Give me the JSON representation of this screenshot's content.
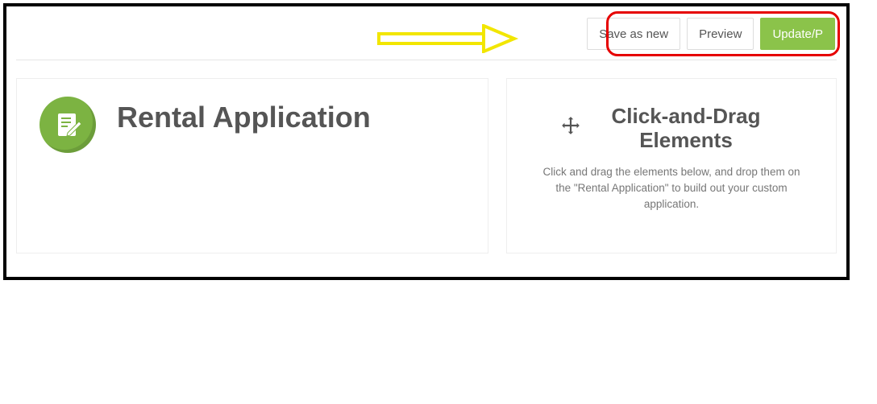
{
  "toolbar": {
    "save_as_new_label": "Save as new",
    "preview_label": "Preview",
    "update_label": "Update/P"
  },
  "left": {
    "title": "Rental Application"
  },
  "right": {
    "title": "Click-and-Drag Elements",
    "description": "Click and drag the elements below, and drop them on the \"Rental Application\" to build out your custom application."
  }
}
